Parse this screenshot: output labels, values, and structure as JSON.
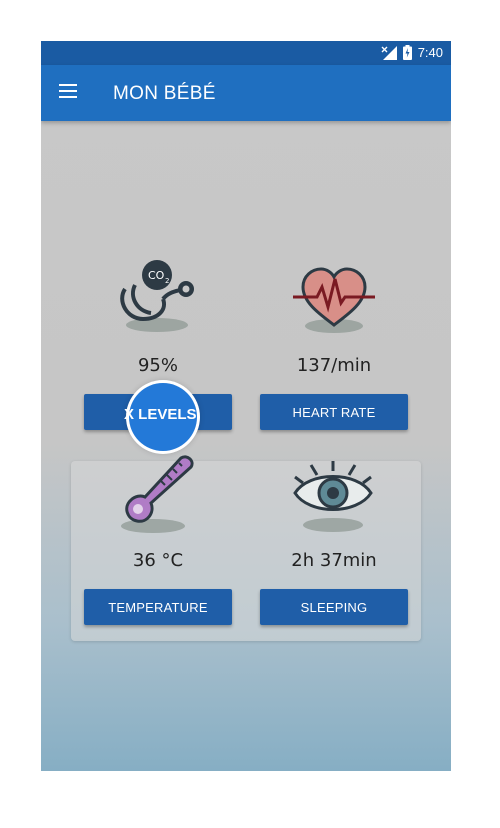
{
  "status_bar": {
    "time": "7:40",
    "icons": [
      "signal-off-icon",
      "battery-charging-icon"
    ]
  },
  "app_bar": {
    "title": "MON BÉBÉ",
    "menu_icon": "hamburger-menu-icon"
  },
  "tiles": [
    {
      "id": "oxygen",
      "icon": "stethoscope-co2-icon",
      "value": "95%",
      "button_label": "X LEVELS"
    },
    {
      "id": "heart",
      "icon": "heart-pulse-icon",
      "value": "137/min",
      "button_label": "HEART RATE"
    },
    {
      "id": "temperature",
      "icon": "thermometer-icon",
      "value": "36 °C",
      "button_label": "TEMPERATURE"
    },
    {
      "id": "sleep",
      "icon": "eye-icon",
      "value": "2h 37min",
      "button_label": "SLEEPING"
    }
  ],
  "colors": {
    "appbar": "#1f6fc0",
    "statusbar": "#1a5ba3",
    "button": "#1f5ea8"
  }
}
